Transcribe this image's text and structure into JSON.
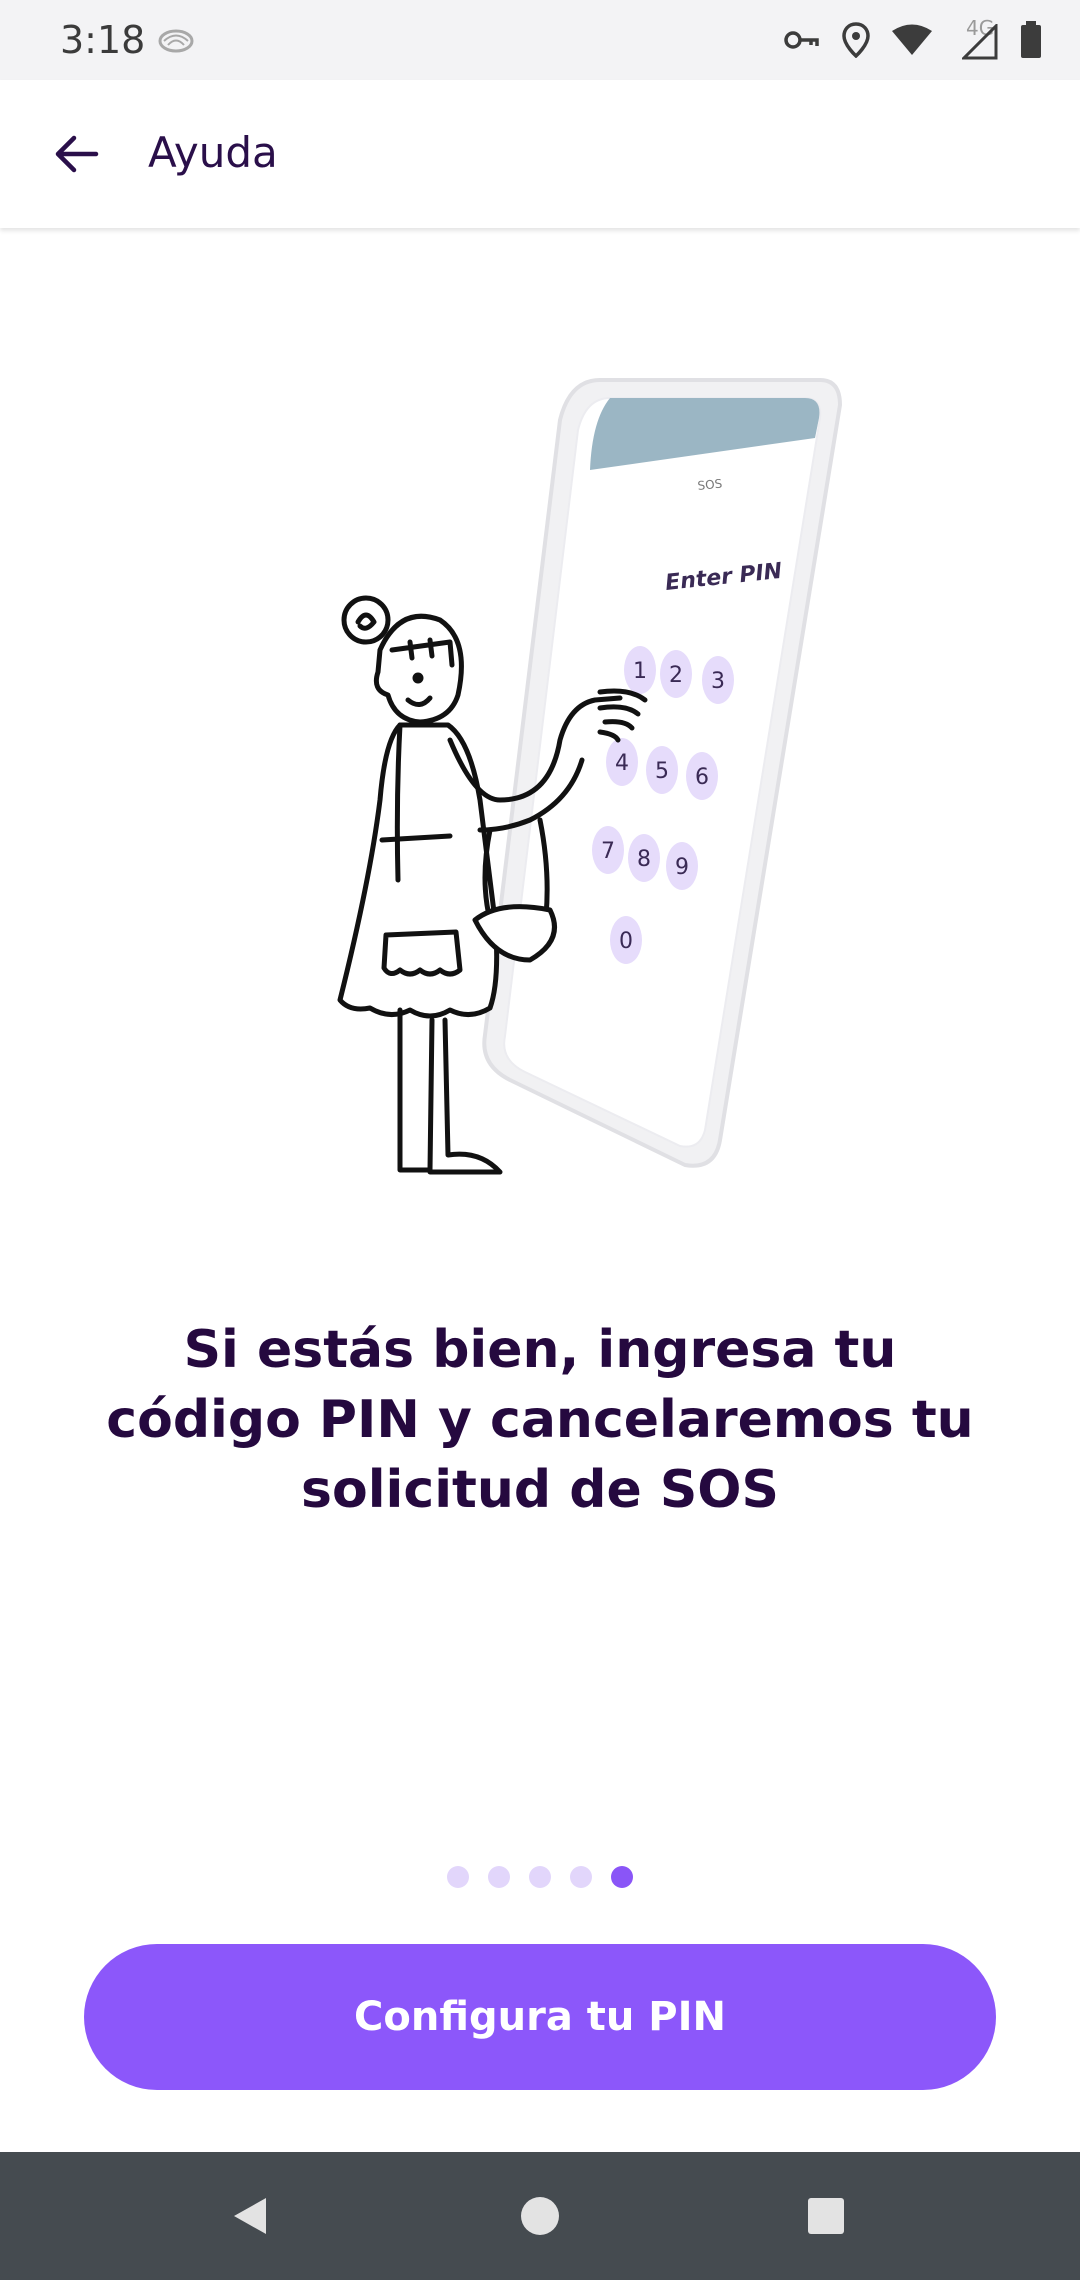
{
  "status_bar": {
    "time": "3:18",
    "network_label": "4G"
  },
  "app_bar": {
    "title": "Ayuda"
  },
  "illustration": {
    "phone_screen": {
      "header": "SOS",
      "title": "Enter PIN",
      "keys": [
        "1",
        "2",
        "3",
        "4",
        "5",
        "6",
        "7",
        "8",
        "9",
        "0"
      ]
    }
  },
  "message": {
    "text": "Si estás bien, ingresa tu código PIN y cancelaremos tu solicitud de SOS"
  },
  "pager": {
    "total": 5,
    "active_index": 4
  },
  "cta": {
    "label": "Configura tu PIN"
  },
  "colors": {
    "accent": "#8c57fa",
    "title_text": "#25093f",
    "dot_inactive": "#e2d6fb",
    "nav_bar": "#454b50"
  }
}
